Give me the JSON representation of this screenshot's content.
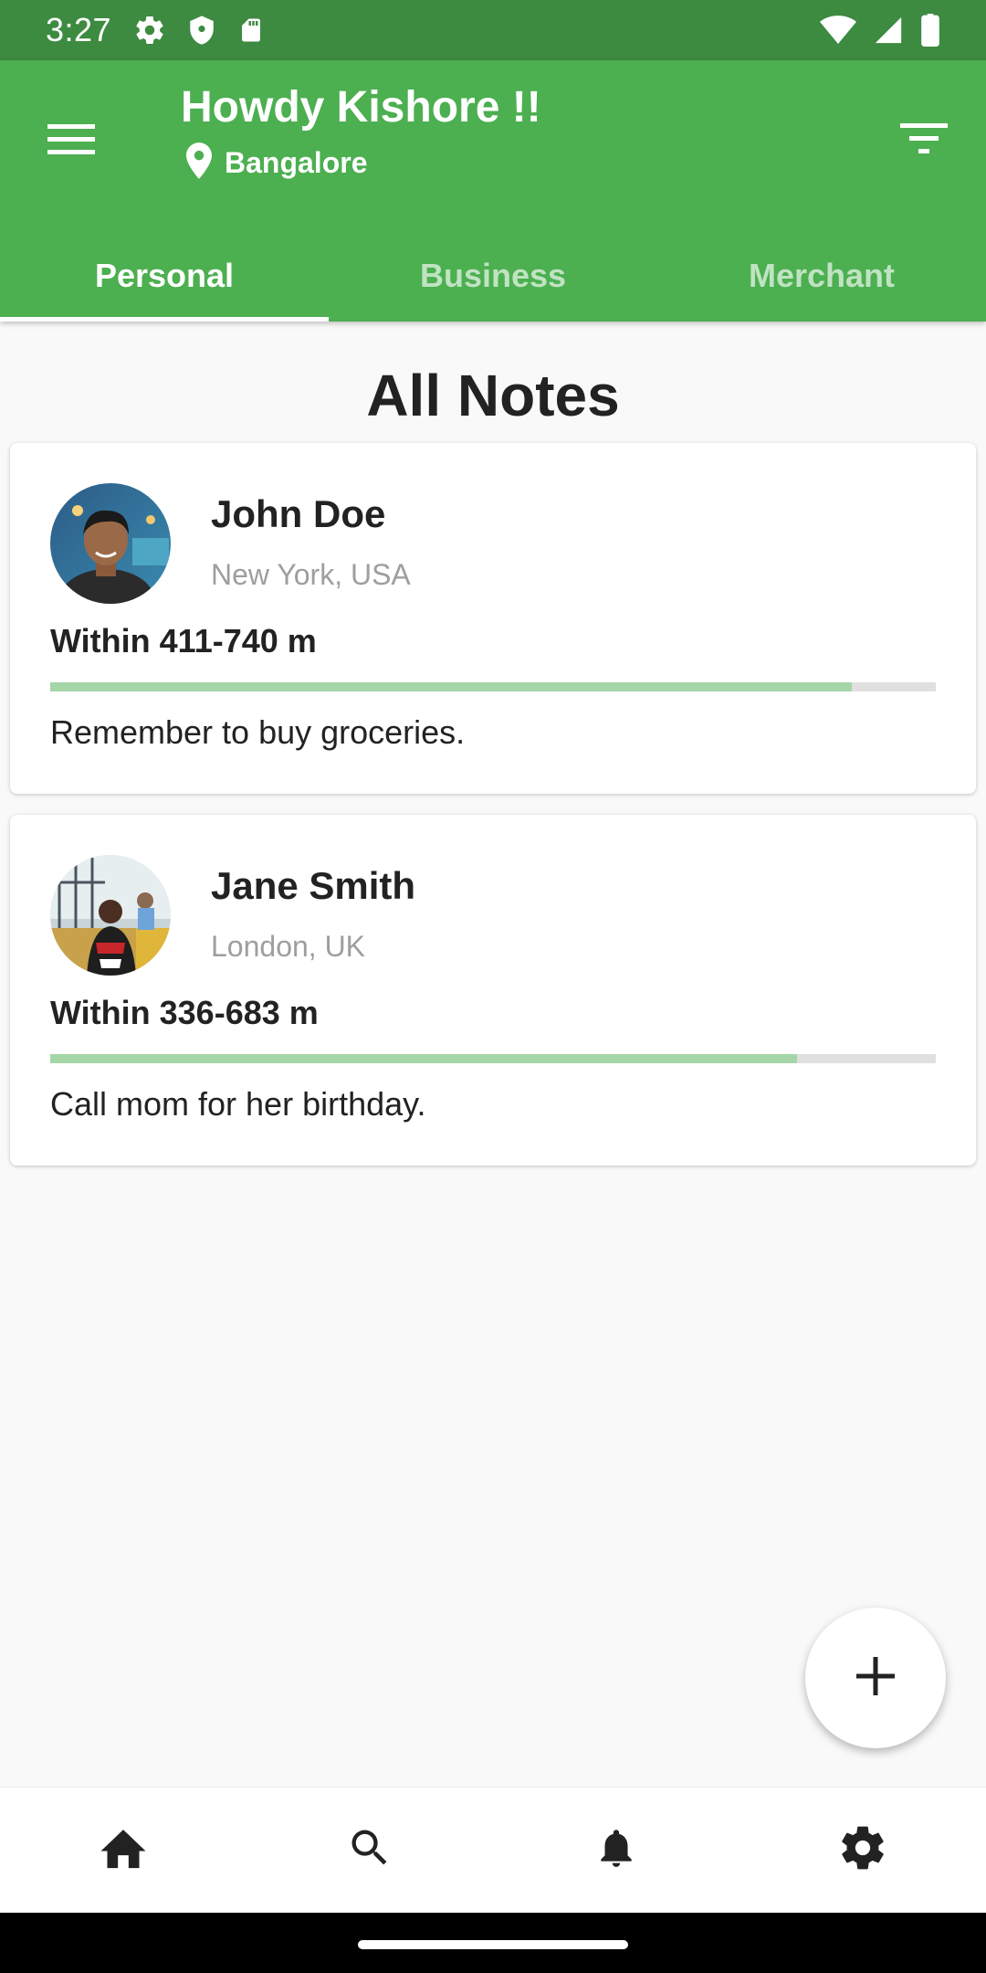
{
  "status_bar": {
    "time": "3:27",
    "icons_left": [
      "settings-icon",
      "shield-icon",
      "sd-card-icon"
    ],
    "icons_right": [
      "wifi-icon",
      "signal-icon",
      "battery-icon"
    ]
  },
  "header": {
    "greeting": "Howdy Kishore !!",
    "location": "Bangalore",
    "menu_icon": "menu-icon",
    "filter_icon": "filter-icon",
    "background_color": "#4caf50"
  },
  "tabs": [
    {
      "label": "Personal",
      "active": true
    },
    {
      "label": "Business",
      "active": false
    },
    {
      "label": "Merchant",
      "active": false
    }
  ],
  "main": {
    "title": "All Notes",
    "notes": [
      {
        "name": "John Doe",
        "location": "New York, USA",
        "distance": "Within 411-740 m",
        "progress": 0.905,
        "note": "Remember to buy groceries."
      },
      {
        "name": "Jane Smith",
        "location": "London, UK",
        "distance": "Within 336-683 m",
        "progress": 0.843,
        "note": "Call mom for her birthday."
      }
    ]
  },
  "fab": {
    "icon": "plus-icon"
  },
  "bottom_nav": [
    "home-icon",
    "search-icon",
    "bell-icon",
    "settings-icon"
  ],
  "colors": {
    "accent": "#4caf50",
    "status_bar": "#3d8a41",
    "progress_fill": "#a5d6a7",
    "progress_track": "#e0e0e0"
  }
}
